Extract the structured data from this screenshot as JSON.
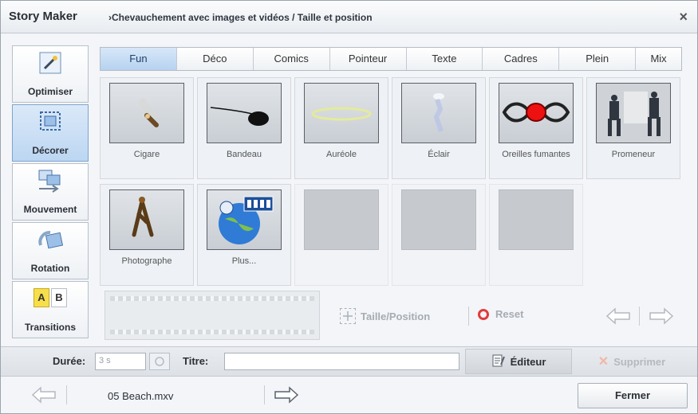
{
  "window": {
    "app_title": "Story Maker",
    "breadcrumb": "›Chevauchement avec images et vidéos / Taille et position",
    "close_label": "×"
  },
  "sidebar": {
    "items": [
      {
        "label": "Optimiser",
        "icon": "magic-wand-icon",
        "active": false
      },
      {
        "label": "Décorer",
        "icon": "frame-icon",
        "active": true
      },
      {
        "label": "Mouvement",
        "icon": "move-icon",
        "active": false
      },
      {
        "label": "Rotation",
        "icon": "rotate-icon",
        "active": false
      },
      {
        "label": "Transitions",
        "icon": "ab-transition-icon",
        "active": false
      }
    ],
    "ab_a": "A",
    "ab_b": "B"
  },
  "tabs": [
    {
      "label": "Fun",
      "active": true
    },
    {
      "label": "Déco",
      "active": false
    },
    {
      "label": "Comics",
      "active": false
    },
    {
      "label": "Pointeur",
      "active": false
    },
    {
      "label": "Texte",
      "active": false
    },
    {
      "label": "Cadres",
      "active": false
    },
    {
      "label": "Plein",
      "active": false
    },
    {
      "label": "Mix",
      "active": false
    }
  ],
  "tiles": [
    {
      "name": "Cigare",
      "icon": "cigar-icon"
    },
    {
      "name": "Bandeau",
      "icon": "eyepatch-icon"
    },
    {
      "name": "Auréole",
      "icon": "halo-icon"
    },
    {
      "name": "Éclair",
      "icon": "lightning-icon"
    },
    {
      "name": "Oreilles fumantes",
      "icon": "smoking-ears-icon"
    },
    {
      "name": "Promeneur",
      "icon": "walkers-icon"
    },
    {
      "name": "Photographe",
      "icon": "photographer-icon"
    },
    {
      "name": "Plus...",
      "icon": "globe-more-icon"
    }
  ],
  "controls": {
    "size_position": "Taille/Position",
    "reset": "Reset"
  },
  "info": {
    "duration_label": "Durée:",
    "duration_value": "3 s",
    "title_label": "Titre:",
    "title_value": "",
    "editor_label": "Éditeur",
    "delete_label": "Supprimer"
  },
  "footer": {
    "file_name": "05 Beach.mxv",
    "close_button": "Fermer"
  },
  "colors": {
    "active_tab": "#b7d2f0",
    "reset_icon": "#e23b3b",
    "window_bg": "#f3f5f8"
  }
}
